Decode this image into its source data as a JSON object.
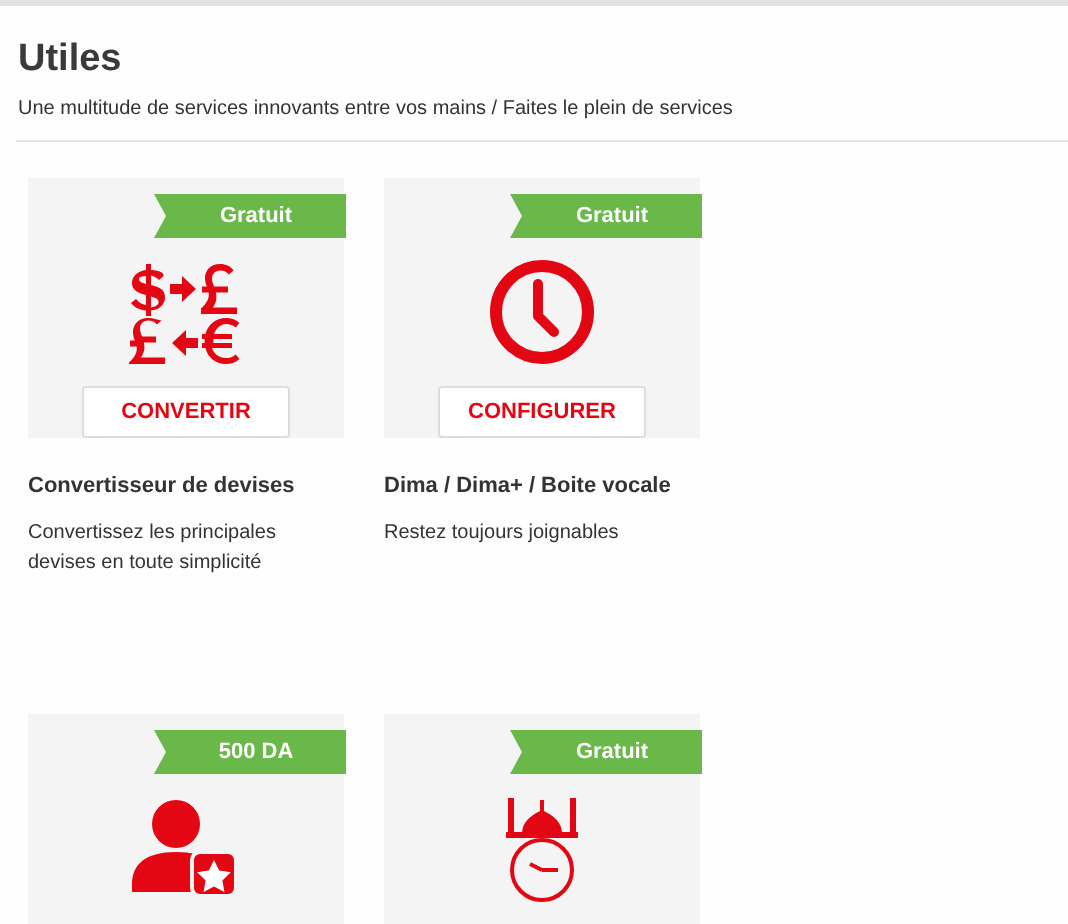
{
  "header": {
    "title": "Utiles",
    "subtitle": "Une multitude de services innovants entre vos mains / Faites le plein de services"
  },
  "services": [
    {
      "kind": "currency",
      "price": "Gratuit",
      "button": "CONVERTIR",
      "name": "Convertisseur de devises",
      "description": "Convertissez les principales devises en toute simplicité"
    },
    {
      "kind": "clock",
      "price": "Gratuit",
      "button": "CONFIGURER",
      "name": "Dima / Dima+ / Boite vocale",
      "description": "Restez toujours joignables"
    },
    {
      "kind": "user-star",
      "price": "500 DA"
    },
    {
      "kind": "mosque-clock",
      "price": "Gratuit"
    }
  ]
}
